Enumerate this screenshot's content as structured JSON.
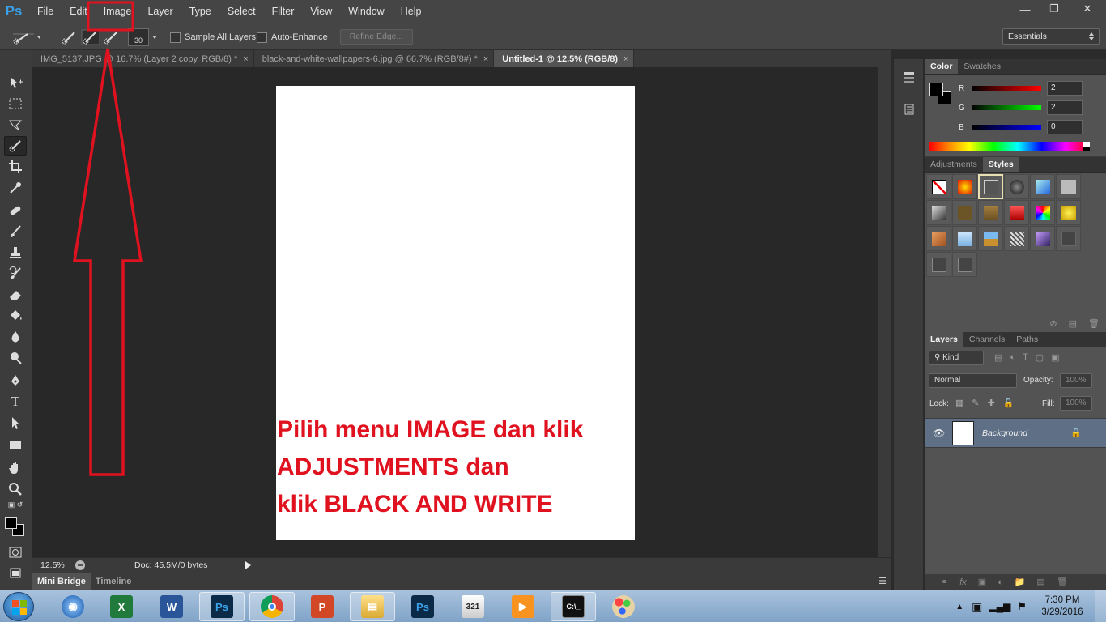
{
  "app": {
    "logo": "Ps"
  },
  "menu": [
    "File",
    "Edit",
    "Image",
    "Layer",
    "Type",
    "Select",
    "Filter",
    "View",
    "Window",
    "Help"
  ],
  "options_bar": {
    "brush_size": "30",
    "sample_all_layers": "Sample All Layers",
    "auto_enhance": "Auto-Enhance",
    "refine_edge": "Refine Edge...",
    "workspace": "Essentials"
  },
  "doc_tabs": [
    {
      "label": "IMG_5137.JPG @ 16.7% (Layer 2 copy, RGB/8) *",
      "active": false
    },
    {
      "label": "black-and-white-wallpapers-6.jpg @ 66.7% (RGB/8#) *",
      "active": false
    },
    {
      "label": "Untitled-1 @ 12.5% (RGB/8)",
      "active": true
    }
  ],
  "annotation": {
    "lines": [
      "Pilih menu IMAGE dan klik",
      "ADJUSTMENTS dan",
      "klik BLACK AND WRITE"
    ],
    "highlighted_menu": "Image"
  },
  "status_bar": {
    "zoom": "12.5%",
    "doc_info": "Doc: 45.5M/0 bytes"
  },
  "bottom_tabs": [
    "Mini Bridge",
    "Timeline"
  ],
  "color_panel": {
    "tabs": [
      "Color",
      "Swatches"
    ],
    "channels": [
      {
        "label": "R",
        "value": "2",
        "color": "#ff0000"
      },
      {
        "label": "G",
        "value": "2",
        "color": "#00c000"
      },
      {
        "label": "B",
        "value": "0",
        "color": "#0000ff"
      }
    ]
  },
  "styles_panel": {
    "tabs": [
      "Adjustments",
      "Styles"
    ]
  },
  "layers_panel": {
    "tabs": [
      "Layers",
      "Channels",
      "Paths"
    ],
    "kind": "Kind",
    "blend_mode": "Normal",
    "opacity_label": "Opacity:",
    "opacity_value": "100%",
    "lock_label": "Lock:",
    "fill_label": "Fill:",
    "fill_value": "100%",
    "layers": [
      {
        "name": "Background"
      }
    ]
  },
  "taskbar": {
    "apps": [
      "media-player",
      "excel",
      "word",
      "photoshop",
      "chrome",
      "powerpoint",
      "file-explorer",
      "photoshop-2",
      "video-editor",
      "media-player-2",
      "command-prompt",
      "paint"
    ],
    "time": "7:30 PM",
    "date": "3/29/2016"
  },
  "colors": {
    "annotation_red": "#e0121f",
    "accent_blue": "#3aa1e8"
  }
}
